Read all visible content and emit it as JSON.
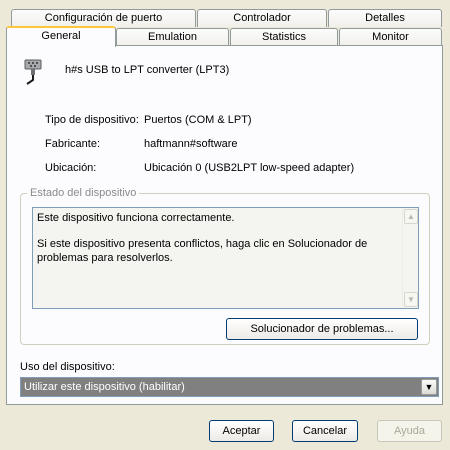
{
  "tabs": {
    "row1": [
      {
        "label": "Configuración de puerto"
      },
      {
        "label": "Controlador"
      },
      {
        "label": "Detalles"
      }
    ],
    "row2": [
      {
        "label": "General",
        "active": true
      },
      {
        "label": "Emulation"
      },
      {
        "label": "Statistics"
      },
      {
        "label": "Monitor"
      }
    ]
  },
  "device": {
    "icon": "printer-port-icon",
    "name": "h#s USB to LPT converter (LPT3)",
    "properties": [
      {
        "label": "Tipo de dispositivo:",
        "value": "Puertos (COM & LPT)"
      },
      {
        "label": "Fabricante:",
        "value": "haftmann#software"
      },
      {
        "label": "Ubicación:",
        "value": "Ubicación 0 (USB2LPT low-speed adapter)"
      }
    ]
  },
  "status": {
    "group_title": "Estado del dispositivo",
    "line1": "Este dispositivo funciona correctamente.",
    "line2": "Si este dispositivo presenta conflictos, haga clic en Solucionador de problemas para resolverlos.",
    "troubleshoot_label": "Solucionador de problemas..."
  },
  "usage": {
    "label": "Uso del dispositivo:",
    "selected": "Utilizar este dispositivo (habilitar)"
  },
  "footer": {
    "ok": "Aceptar",
    "cancel": "Cancelar",
    "help": "Ayuda"
  },
  "colors": {
    "dialog_bg": "#ece9d8",
    "panel_bg": "#fcfcfe",
    "active_tab_accent": "#ffc83c",
    "button_border": "#003c74",
    "select_highlight": "#808080"
  }
}
